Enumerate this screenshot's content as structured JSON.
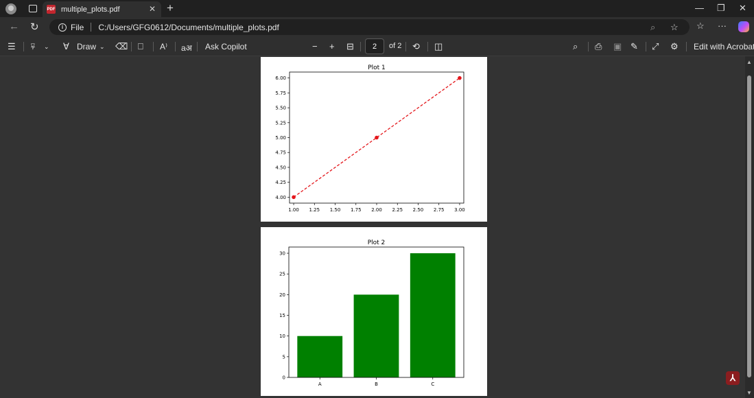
{
  "browser": {
    "tab_title": "multiple_plots.pdf",
    "tab_icon_text": "PDF",
    "file_label": "File",
    "url": "C:/Users/GFG0612/Documents/multiple_plots.pdf"
  },
  "pdf_toolbar": {
    "draw_label": "Draw",
    "ask_copilot_label": "Ask Copilot",
    "read_aloud_label": "A⁾",
    "translate_label": "aअ",
    "page_number": "2",
    "page_total_label": "of 2",
    "edit_acrobat_label": "Edit with Acrobat"
  },
  "colors": {
    "line_color": "#e4161b",
    "bar_color": "#008000"
  },
  "chart_data": [
    {
      "type": "line",
      "title": "Plot 1",
      "x": [
        1.0,
        2.0,
        3.0
      ],
      "y": [
        4.0,
        5.0,
        6.0
      ],
      "line_style": "dashed",
      "marker": "circle",
      "xlim": [
        0.95,
        3.05
      ],
      "ylim": [
        3.9,
        6.1
      ],
      "xticks": [
        1.0,
        1.25,
        1.5,
        1.75,
        2.0,
        2.25,
        2.5,
        2.75,
        3.0
      ],
      "xtick_labels": [
        "1.00",
        "1.25",
        "1.50",
        "1.75",
        "2.00",
        "2.25",
        "2.50",
        "2.75",
        "3.00"
      ],
      "yticks": [
        4.0,
        4.25,
        4.5,
        4.75,
        5.0,
        5.25,
        5.5,
        5.75,
        6.0
      ],
      "ytick_labels": [
        "4.00",
        "4.25",
        "4.50",
        "4.75",
        "5.00",
        "5.25",
        "5.50",
        "5.75",
        "6.00"
      ],
      "grid": false
    },
    {
      "type": "bar",
      "title": "Plot 2",
      "categories": [
        "A",
        "B",
        "C"
      ],
      "values": [
        10,
        20,
        30
      ],
      "ylim": [
        0,
        31.5
      ],
      "yticks": [
        0,
        5,
        10,
        15,
        20,
        25,
        30
      ],
      "ytick_labels": [
        "0",
        "5",
        "10",
        "15",
        "20",
        "25",
        "30"
      ],
      "grid": false
    }
  ]
}
